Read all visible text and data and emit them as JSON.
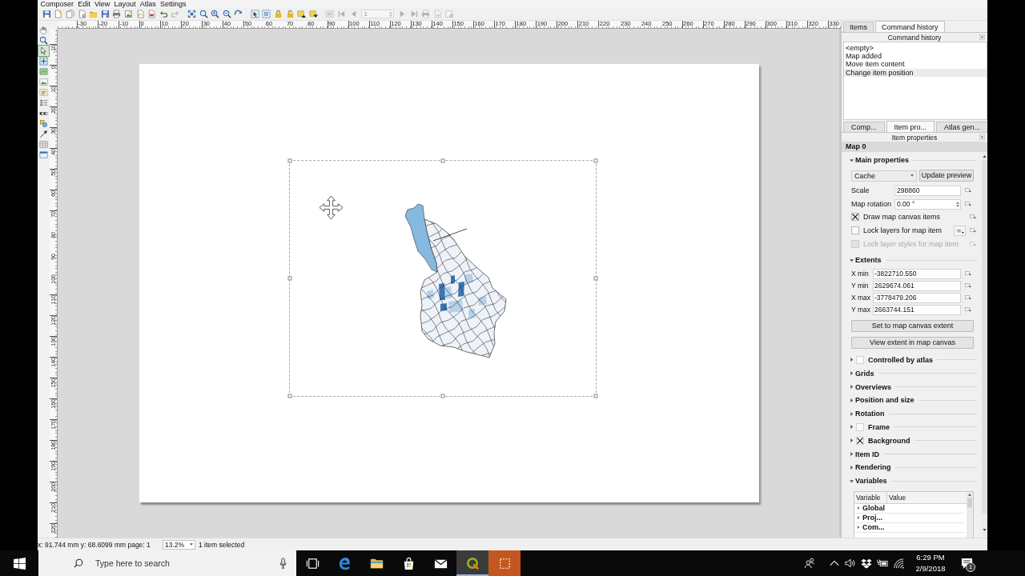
{
  "menu": [
    "Composer",
    "Edit",
    "View",
    "Layout",
    "Atlas",
    "Settings"
  ],
  "toolbar": {
    "redo_disabled": true,
    "atlas_disabled": true,
    "page_number": "1"
  },
  "tools": [
    {
      "selected": false
    },
    {
      "selected": false
    },
    {
      "selected": true
    },
    {
      "selected": false
    },
    {
      "selected": false
    },
    {
      "selected": false
    },
    {
      "selected": false
    },
    {
      "selected": false
    },
    {
      "selected": false
    },
    {
      "selected": false
    },
    {
      "selected": false
    },
    {
      "selected": false
    },
    {
      "selected": false
    }
  ],
  "rulers": {
    "horizontal": [
      "-30",
      "-20",
      "-10",
      "0",
      "10",
      "20",
      "30",
      "40",
      "50",
      "60",
      "70",
      "80",
      "90",
      "100",
      "110",
      "120",
      "130",
      "140",
      "150",
      "160",
      "170",
      "180",
      "190",
      "200",
      "210",
      "220",
      "230",
      "240",
      "250",
      "260",
      "270",
      "280",
      "290",
      "300",
      "310",
      "320",
      "330"
    ],
    "vertical": [
      "-10",
      "0",
      "10",
      "20",
      "30",
      "40",
      "50",
      "60",
      "70",
      "80",
      "90",
      "100",
      "110",
      "120",
      "130",
      "140",
      "150",
      "160",
      "170",
      "180",
      "190",
      "200",
      "210",
      "220"
    ]
  },
  "map_item": {
    "selected": true
  },
  "history_panel": {
    "tabs": [
      {
        "label": "Items",
        "selected": false
      },
      {
        "label": "Command history",
        "selected": true
      }
    ],
    "title": "Command history",
    "entries": [
      {
        "text": "<empty>",
        "selected": false
      },
      {
        "text": "Map added",
        "selected": false
      },
      {
        "text": "Move item content",
        "selected": false
      },
      {
        "text": "Change item position",
        "selected": true
      }
    ]
  },
  "properties_panel": {
    "tabs": [
      {
        "label": "Comp...",
        "selected": false
      },
      {
        "label": "Item pro...",
        "selected": true
      },
      {
        "label": "Atlas gen...",
        "selected": false
      }
    ],
    "title": "Item properties",
    "item": "Map 0",
    "sections": [
      {
        "kind": "map",
        "title": "Main properties",
        "expanded": true,
        "preview_mode": "Cache",
        "update_button": "Update preview",
        "scale_label": "Scale",
        "scale": "298860",
        "rotation_label": "Map rotation",
        "rotation": "0.00 °",
        "options": [
          {
            "label": "Draw map canvas items",
            "checked": true,
            "disabled": false
          },
          {
            "label": "Lock layers for map item",
            "checked": false,
            "disabled": false
          },
          {
            "label": "Lock layer styles for map item",
            "checked": false,
            "disabled": true
          }
        ]
      },
      {
        "kind": "extents",
        "title": "Extents",
        "expanded": true,
        "fields": [
          {
            "label": "X min",
            "value": "-3822710.550"
          },
          {
            "label": "Y min",
            "value": "2629674.061"
          },
          {
            "label": "X max",
            "value": "-3778479.206"
          },
          {
            "label": "Y max",
            "value": "2663744.151"
          }
        ],
        "buttons": [
          "Set to map canvas extent",
          "View extent in map canvas"
        ]
      },
      {
        "kind": "checkable",
        "title": "Controlled by atlas",
        "checked": false,
        "expanded": false
      },
      {
        "kind": "plain",
        "title": "Grids",
        "expanded": false
      },
      {
        "kind": "plain",
        "title": "Overviews",
        "expanded": false
      },
      {
        "kind": "plain",
        "title": "Position and size",
        "expanded": false
      },
      {
        "kind": "plain",
        "title": "Rotation",
        "expanded": false
      },
      {
        "kind": "checkable",
        "title": "Frame",
        "checked": false,
        "expanded": false
      },
      {
        "kind": "checkable",
        "title": "Background",
        "checked": true,
        "expanded": false
      },
      {
        "kind": "plain",
        "title": "Item ID",
        "expanded": false
      },
      {
        "kind": "plain",
        "title": "Rendering",
        "expanded": false
      },
      {
        "kind": "table",
        "title": "Variables",
        "expanded": true,
        "columns": [
          "Variable",
          "Value"
        ],
        "rows": [
          {
            "name": "Global",
            "expanded": false
          },
          {
            "name": "Proj...",
            "expanded": false
          },
          {
            "name": "Com...",
            "expanded": false
          }
        ]
      }
    ]
  },
  "status_bar": {
    "position": "x: 91.744 mm y: 68.6099 mm page: 1",
    "zoom": "13.2%",
    "selection": "1 item selected"
  },
  "taskbar": {
    "search_placeholder": "Type here to search",
    "apps": [
      {
        "kind": "task-view",
        "active": false,
        "attention": false
      },
      {
        "kind": "browser",
        "active": false,
        "attention": false
      },
      {
        "kind": "explorer",
        "active": false,
        "attention": false
      },
      {
        "kind": "store",
        "active": false,
        "attention": false
      },
      {
        "kind": "mail",
        "active": false,
        "attention": false
      },
      {
        "kind": "qgis",
        "active": true,
        "attention": false
      },
      {
        "kind": "recorder",
        "active": false,
        "attention": true
      }
    ],
    "time": "6:29 PM",
    "date": "2/9/2018",
    "notifications": "1"
  }
}
